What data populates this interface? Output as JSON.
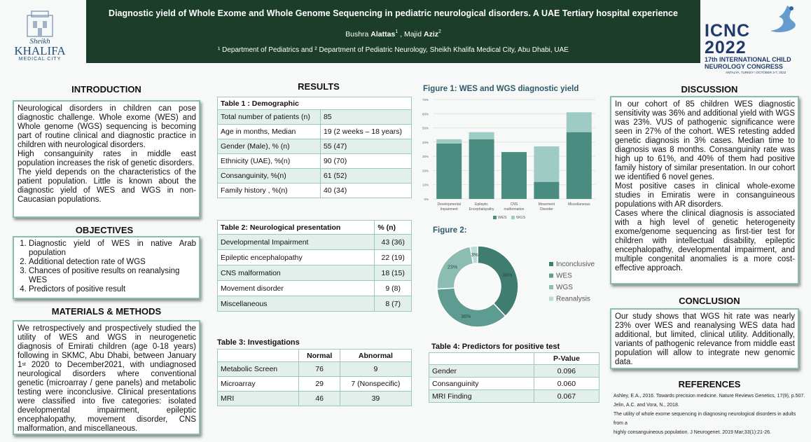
{
  "header": {
    "title": "Diagnostic yield of Whole Exome and Whole Genome Sequencing in pediatric neurological disorders. A UAE Tertiary hospital experience",
    "author1_first": "Bushra ",
    "author1_last": "Alattas",
    "author1_sup": "1",
    "author_sep": " , Majid ",
    "author2_last": "Aziz",
    "author2_sup": "2",
    "affiliations": "¹ Department of Pediatrics and ² Department of Pediatric Neurology, Sheikh Khalifa Medical City, Abu Dhabi, UAE",
    "logo_left": {
      "line1": "Sheikh",
      "line2": "KHALIFA",
      "line3": "MEDICAL CITY"
    },
    "logo_right": {
      "line1": "ICNC",
      "line2": "2022",
      "line3": "17th INTERNATIONAL CHILD",
      "line4": "NEUROLOGY CONGRESS",
      "line5": "ANTALYA, TURKEY I OCTOBER 3-7, 2022"
    }
  },
  "introduction": {
    "heading": "INTRODUCTION",
    "p1": "Neurological disorders in children can pose diagnostic challenge. Whole exome (WES) and Whole genome (WGS) sequencing is becoming part of routine clinical and diagnostic practice in children with neurological disorders.",
    "p2": "High consanguinity rates in middle east population increases the risk of genetic disorders.",
    "p3": "The yield depends on the characteristics of the patient population. Little is known about the diagnostic yield of WES and WGS in non-Caucasian populations."
  },
  "objectives": {
    "heading": "OBJECTIVES",
    "items": [
      "Diagnostic yield of WES in native Arab population",
      "Additional detection rate of WGS",
      "Chances of positive results on reanalysing WES",
      "Predictors of positive result"
    ]
  },
  "methods": {
    "heading": "MATERIALS & METHODS",
    "text_before": "We retrospectively and prospectively studied the utility of WES and WGS in neurogenetic diagnosis of Emirati children (age 0-18 years) following in SKMC, Abu Dhabi, between January 1",
    "sup": "st",
    "text_after": " 2020 to December2021, with undiagnosed neurological disorders where conventional genetic (microarray / gene panels) and metabolic testing were inconclusive. Clinical presentations were classified into five categories: isolated developmental impairment, epileptic encephalopathy, movement disorder, CNS malformation, and miscellaneous."
  },
  "results": {
    "heading": "RESULTS"
  },
  "table1": {
    "title": "Table 1 : Demographic",
    "rows": [
      [
        "Total number of patients (n)",
        "85"
      ],
      [
        "Age in months, Median",
        "19  (2 weeks – 18 years)"
      ],
      [
        "Gender (Male), % (n)",
        "55 (47)"
      ],
      [
        "Ethnicity (UAE), %(n)",
        "90 (70)"
      ],
      [
        "Consanguinity, %(n)",
        "61 (52)"
      ],
      [
        "Family history , %(n)",
        "40 (34)"
      ]
    ]
  },
  "table2": {
    "title": "Table 2:  Neurological presentation",
    "col": "% (n)",
    "rows": [
      [
        "Developmental Impairment",
        "43 (36)"
      ],
      [
        "Epileptic encephalopathy",
        "22 (19)"
      ],
      [
        "CNS malformation",
        "18 (15)"
      ],
      [
        "Movement disorder",
        "9  (8)"
      ],
      [
        "Miscellaneous",
        "8  (7)"
      ]
    ]
  },
  "table3": {
    "title": "Table 3: Investigations",
    "headers": [
      "",
      "Normal",
      "Abnormal"
    ],
    "rows": [
      [
        "Metabolic Screen",
        "76",
        "9"
      ],
      [
        "Microarray",
        "29",
        "7 (Nonspecific)"
      ],
      [
        "MRI",
        "46",
        "39"
      ]
    ]
  },
  "table4": {
    "title": "Table 4: Predictors for positive test",
    "headers": [
      "",
      "P-Value"
    ],
    "rows": [
      [
        "Gender",
        "0.096"
      ],
      [
        "Consanguinity",
        "0.060"
      ],
      [
        "MRI Finding",
        "0.067"
      ]
    ]
  },
  "figure1": {
    "title": "Figure 1: WES and WGS diagnostic yield"
  },
  "figure2": {
    "title": "Figure 2:"
  },
  "chart_data": [
    {
      "type": "bar",
      "stacked": true,
      "categories": [
        "Developmental Impairment",
        "Epileptic Encephalopathy",
        "CNS malformation",
        "Movement Disorder",
        "Miscellaneous"
      ],
      "series": [
        {
          "name": "WES",
          "values": [
            39,
            42,
            33,
            12,
            47
          ]
        },
        {
          "name": "WGS",
          "values": [
            3,
            5,
            0,
            25,
            14
          ]
        }
      ],
      "ytick_labels": [
        "0%",
        "10%",
        "20%",
        "30%",
        "40%",
        "50%",
        "60%",
        "70%"
      ],
      "ylim": [
        0,
        70
      ],
      "grid": true,
      "legend": "bottom",
      "colors": [
        "#4a8c80",
        "#9ecbc4"
      ]
    },
    {
      "type": "pie",
      "donut": true,
      "labels": [
        "Inconclusive",
        "WES",
        "WGS",
        "Reanalysis"
      ],
      "values": [
        38,
        36,
        23,
        3
      ],
      "data_labels": [
        "38%",
        "36%",
        "23%",
        "3%"
      ],
      "legend": "right",
      "colors": [
        "#3f7d71",
        "#5e9b90",
        "#8cbdb3",
        "#bcdcd5"
      ]
    }
  ],
  "discussion": {
    "heading": "DISCUSSION",
    "p1": "In our cohort of  85 children WES diagnostic sensitivity was 36% and additional yield with WGS was 23%. VUS of pathogenic significance were seen in 27% of the cohort.  WES retesting added genetic diagnosis in 3% cases. Median time to diagnosis was 8 months. Consanguinity rate was high up to 61%, and 40% of them had positive family history of similar presentation. In our cohort we identified 6 novel genes.",
    "p2": "Most positive cases in clinical whole-exome studies in Emiratis were in consanguineous populations with AR disorders.",
    "p3": "Cases where the clinical diagnosis is associated with a high level of genetic heterogeneity exome/genome sequencing as first-tier test for children with intellectual disability, epileptic encephalopathy, developmental impairment, and multiple congenital anomalies is a more cost-effective approach."
  },
  "conclusion": {
    "heading": "CONCLUSION",
    "text": "Our study shows that WGS hit rate was nearly 23% over WES and reanalysing WES data had additional, but limited, clinical utility. Additionally, variants of pathogenic relevance from middle east population will allow to integrate new genomic data."
  },
  "references": {
    "heading": "REFERENCES",
    "items": [
      "Ashley, E.A., 2016. Towards precision medicine. Nature Reviews Genetics, 17(9), p.507.",
      "Jelin, A.C. and Vora, N., 2018.",
      "The utility of whole exome sequencing in diagnosing neurological disorders in adults from a",
      "highly consanguineous population. J Neurogenet. 2019 Mar;33(1):21-26."
    ]
  }
}
